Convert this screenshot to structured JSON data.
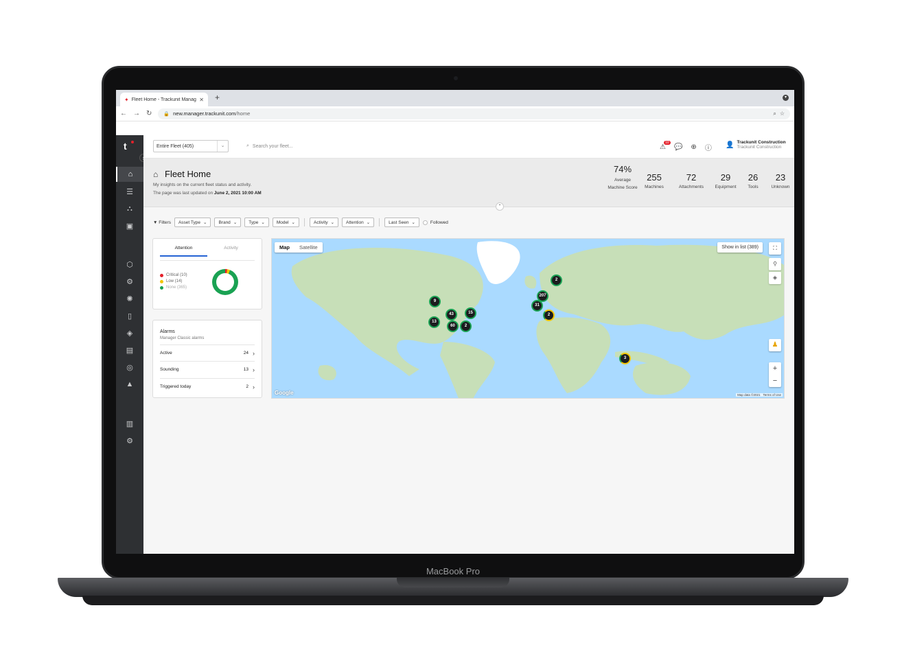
{
  "device": {
    "label": "MacBook Pro"
  },
  "browser": {
    "tab_title": "Fleet Home - Trackunit Manag",
    "url_host": "new.manager.trackunit.com",
    "url_path": "/home"
  },
  "topbar": {
    "fleet_select": "Entire Fleet (405)",
    "search_placeholder": "Search your fleet...",
    "alert_count": "10",
    "user_name": "Trackunit Construction",
    "user_org": "Trackunit Construction"
  },
  "header": {
    "title": "Fleet Home",
    "description": "My insights on the current fleet status and activity.",
    "updated_prefix": "The page was last updated on",
    "updated_value": "June 2, 2021 10:00 AM"
  },
  "stats": [
    {
      "value": "74%",
      "label": "Average Machine Score"
    },
    {
      "value": "255",
      "label": "Machines"
    },
    {
      "value": "72",
      "label": "Attachments"
    },
    {
      "value": "29",
      "label": "Equipment"
    },
    {
      "value": "26",
      "label": "Tools"
    },
    {
      "value": "23",
      "label": "Unknown"
    }
  ],
  "filters": {
    "label": "Filters",
    "items": [
      "Asset Type",
      "Brand",
      "Type",
      "Model",
      "Activity",
      "Attention",
      "Last Seen"
    ],
    "followed": "Followed"
  },
  "attention": {
    "tabs": [
      "Attention",
      "Activity"
    ],
    "legend": [
      {
        "label": "Critical (10)",
        "color": "#e4212b"
      },
      {
        "label": "Low (14)",
        "color": "#f2c500"
      },
      {
        "label": "None (365)",
        "color": "#1aa253"
      }
    ]
  },
  "alarms": {
    "title": "Alarms",
    "subtitle": "Manager Classic alarms",
    "rows": [
      {
        "label": "Active",
        "count": "24"
      },
      {
        "label": "Sounding",
        "count": "13"
      },
      {
        "label": "Triggered today",
        "count": "2"
      }
    ]
  },
  "map": {
    "tabs": [
      "Map",
      "Satellite"
    ],
    "show_list": "Show in list (389)",
    "google": "Google",
    "map_data": "Map data ©2021",
    "terms": "Terms of Use",
    "clusters": [
      "2",
      "9",
      "207",
      "31",
      "2",
      "43",
      "15",
      "13",
      "60",
      "2",
      "3"
    ]
  }
}
